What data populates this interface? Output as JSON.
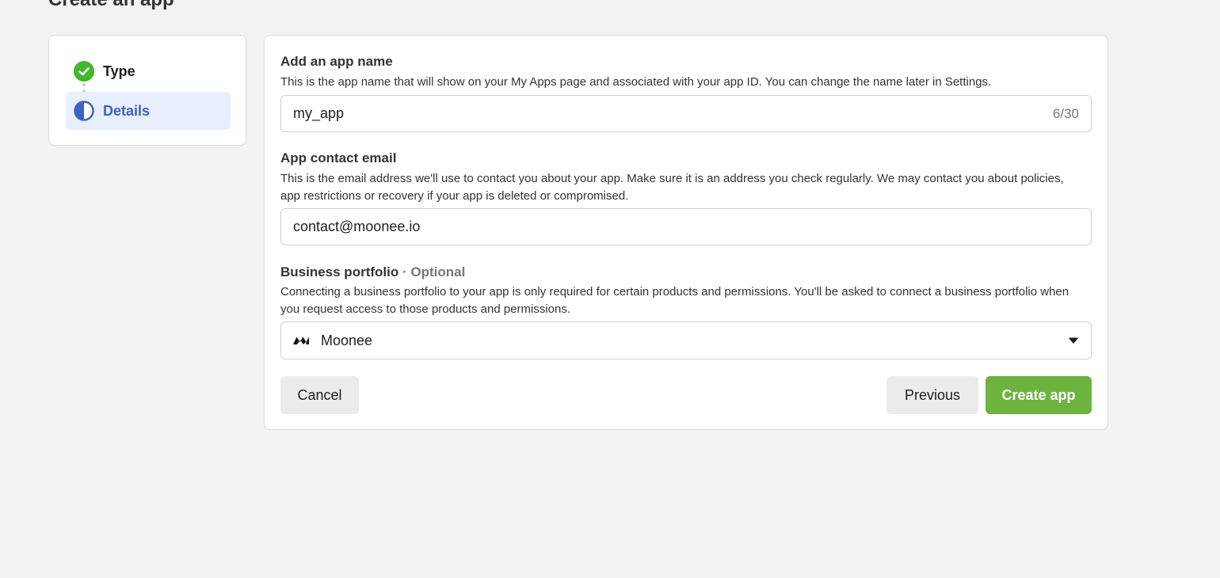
{
  "page": {
    "title": "Create an app"
  },
  "stepper": {
    "steps": [
      {
        "label": "Type",
        "state": "complete",
        "icon": "check-circle-icon"
      },
      {
        "label": "Details",
        "state": "in-progress",
        "icon": "half-circle-icon"
      }
    ]
  },
  "form": {
    "app_name": {
      "title": "Add an app name",
      "description": "This is the app name that will show on your My Apps page and associated with your app ID. You can change the name later in Settings.",
      "value": "my_app",
      "counter": "6/30"
    },
    "contact_email": {
      "title": "App contact email",
      "description": "This is the email address we'll use to contact you about your app. Make sure it is an address you check regularly. We may contact you about policies, app restrictions or recovery if your app is deleted or compromised.",
      "value": "contact@moonee.io"
    },
    "business_portfolio": {
      "title": "Business portfolio",
      "optional": "· Optional",
      "description": "Connecting a business portfolio to your app is only required for certain products and permissions. You'll be asked to connect a business portfolio when you request access to those products and permissions.",
      "selected": "Moonee",
      "logo_icon": "moonee-logo-icon"
    },
    "buttons": {
      "cancel": "Cancel",
      "previous": "Previous",
      "create": "Create app"
    }
  },
  "colors": {
    "accent_blue": "#3c63c6",
    "active_step_bg": "#e7eefc",
    "success_green": "#42b72a",
    "create_button": "#6db33f",
    "background": "#f2f2f2"
  }
}
